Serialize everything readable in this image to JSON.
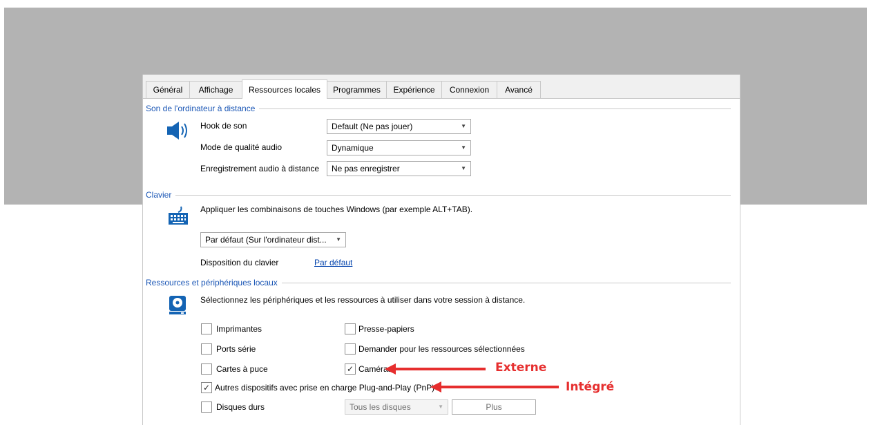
{
  "tabs": [
    {
      "label": "Général"
    },
    {
      "label": "Affichage"
    },
    {
      "label": "Ressources locales",
      "active": true
    },
    {
      "label": "Programmes"
    },
    {
      "label": "Expérience"
    },
    {
      "label": "Connexion"
    },
    {
      "label": "Avancé"
    }
  ],
  "sound": {
    "title": "Son de l'ordinateur à distance",
    "icon": "speaker-icon",
    "rows": [
      {
        "label": "Hook de son",
        "value": "Default (Ne pas jouer)"
      },
      {
        "label": "Mode de qualité audio",
        "value": "Dynamique"
      },
      {
        "label": "Enregistrement audio à distance",
        "value": "Ne pas enregistrer"
      }
    ]
  },
  "keyboard": {
    "title": "Clavier",
    "icon": "keyboard-icon",
    "description": "Appliquer les combinaisons de touches Windows (par exemple ALT+TAB).",
    "select_value": "Par défaut (Sur l'ordinateur dist...",
    "layout_label": "Disposition du clavier",
    "layout_link": "Par défaut"
  },
  "devices": {
    "title": "Ressources et périphériques locaux",
    "icon": "drive-icon",
    "description": "Sélectionnez les périphériques et les ressources à utiliser dans votre session à distance.",
    "printers": {
      "label": "Imprimantes",
      "checked": false
    },
    "clipboard": {
      "label": "Presse-papiers",
      "checked": false
    },
    "serial_ports": {
      "label": "Ports série",
      "checked": false
    },
    "ask_selected": {
      "label": "Demander pour les ressources sélectionnées",
      "checked": false
    },
    "smart_cards": {
      "label": "Cartes à puce",
      "checked": false
    },
    "cameras": {
      "label": "Caméras",
      "checked": true
    },
    "pnp": {
      "label": "Autres dispositifs avec prise en charge Plug-and-Play (PnP)",
      "checked": true
    },
    "hard_disks": {
      "label": "Disques durs",
      "checked": false
    },
    "disks_select": "Tous les disques",
    "more_button": "Plus"
  },
  "annotations": {
    "external": "Externe",
    "integrated": "Intégré",
    "color": "#e62e2e"
  },
  "colors": {
    "section_title": "#1a56b5",
    "link": "#0645ad",
    "backdrop": "#b3b3b3"
  }
}
